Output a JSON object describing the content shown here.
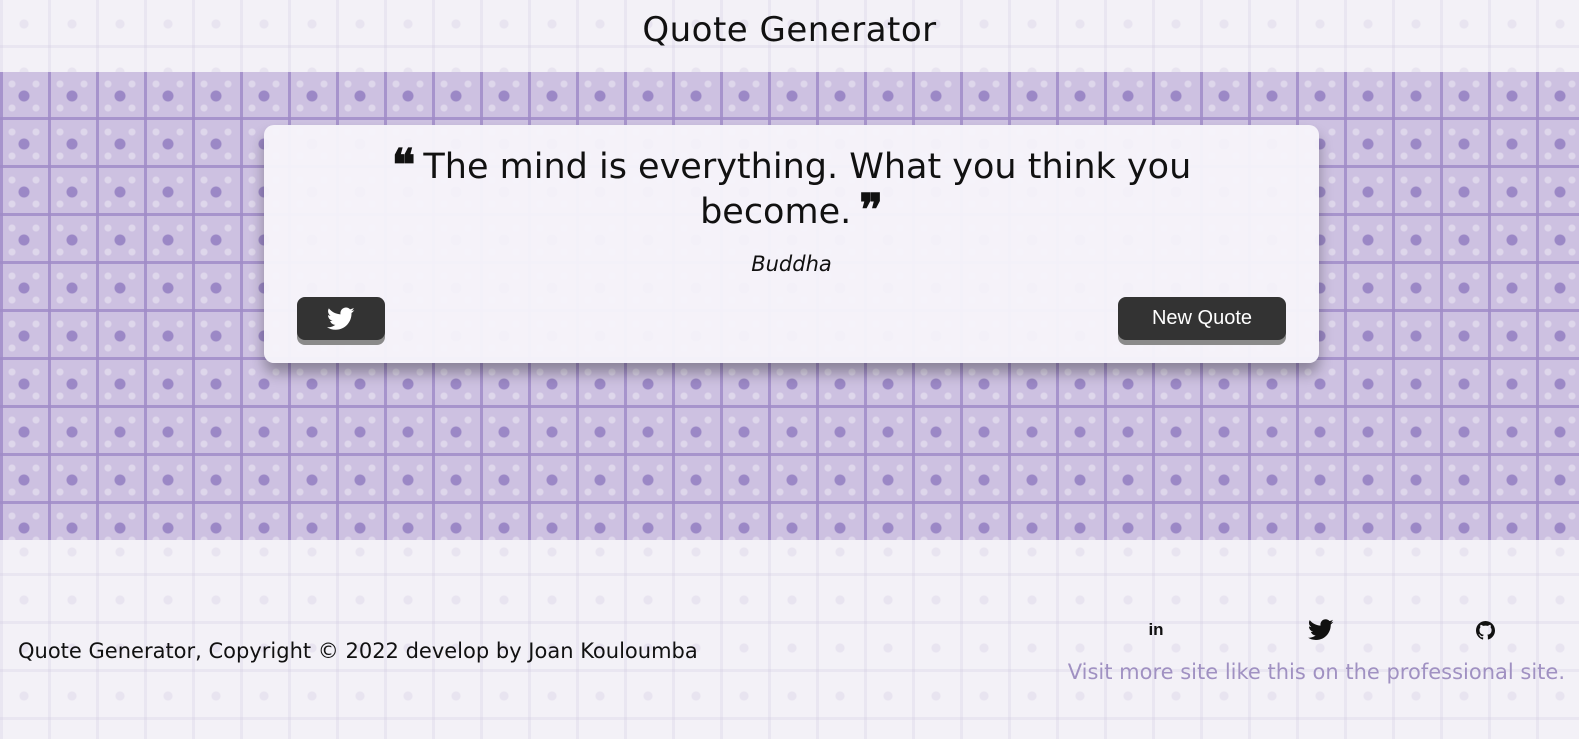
{
  "header": {
    "title": "Quote Generator"
  },
  "quote": {
    "text": "The mind is everything. What you think you become.",
    "author": "Buddha",
    "open_mark": "❝",
    "close_mark": "❞"
  },
  "buttons": {
    "tweet_icon": "twitter-icon",
    "new_quote_label": "New Quote"
  },
  "footer": {
    "copyright": "Quote Generator, Copyright © 2022 develop by Joan Kouloumba",
    "social": [
      {
        "name": "linkedin-icon",
        "label": "in"
      },
      {
        "name": "twitter-icon"
      },
      {
        "name": "github-icon"
      }
    ],
    "note": "Visit more site like this on the professional site."
  },
  "colors": {
    "button_bg": "#333333",
    "footer_note": "#a091c2",
    "band_bg": "#cdc1e1"
  }
}
